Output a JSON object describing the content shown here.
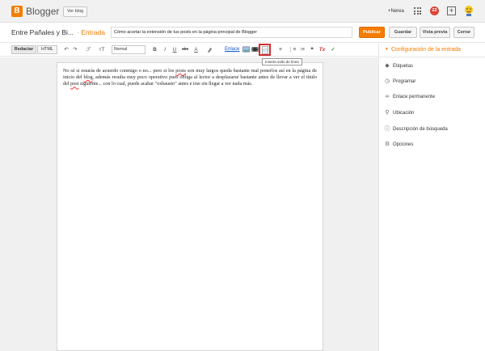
{
  "header": {
    "logo_letter": "B",
    "app_name": "Blogger",
    "view_blog": "Ver blog",
    "user_name": "+Nerea",
    "notification_count": "22",
    "plus_symbol": "+"
  },
  "post_bar": {
    "blog_name": "Entre Pañales y Bi...",
    "section": "· Entrada",
    "post_title": "Cómo acortar la extensión de tus posts en la página principal de Blogger",
    "buttons": {
      "publish": "Publicar",
      "save": "Guardar",
      "preview": "Vista previa",
      "close": "Cerrar"
    }
  },
  "toolbar": {
    "compose_tab": "Redactar",
    "html_tab": "HTML",
    "undo": "↶",
    "redo": "↷",
    "font_family": "ℱ",
    "font_size": "ᴛT",
    "format_select": "Normal",
    "bold": "B",
    "italic": "I",
    "underline": "U",
    "strike": "abc",
    "text_color": "A",
    "link": "Enlace",
    "align": "≡",
    "numbered_list": "⋮≡",
    "bullet_list": "⁝≡",
    "quote": "❝",
    "clear_format": "Tx",
    "spell": "✓",
    "jump_break_tooltip": "Inserta salto de línea"
  },
  "editor": {
    "segments": [
      "No sé si estarás de acuerdo conmigo o no... pero si los ",
      "posts",
      " son muy largos queda bastante mal ponerlos así en la página de inicio del ",
      "blog",
      ", además resulta muy poco operativo pues obliga al lector a desplazarse bastante antes de llevar a ver el título del ",
      "post",
      " siguiente... con lo cual, puede acabar \"exhausto\" antes e irse sin llegar a ver nada más."
    ]
  },
  "sidebar": {
    "header": "Configuración de la entrada",
    "items": [
      {
        "label": "Etiquetas",
        "icon": "tag-icon"
      },
      {
        "label": "Programar",
        "icon": "clock-icon"
      },
      {
        "label": "Enlace permanente",
        "icon": "link-icon"
      },
      {
        "label": "Ubicación",
        "icon": "location-pin-icon"
      },
      {
        "label": "Descripción de búsqueda",
        "icon": "info-icon"
      },
      {
        "label": "Opciones",
        "icon": "gear-icon"
      }
    ]
  },
  "colors": {
    "brand": "#f57d00",
    "highlight": "#d32f2f",
    "notification": "#db4437"
  }
}
